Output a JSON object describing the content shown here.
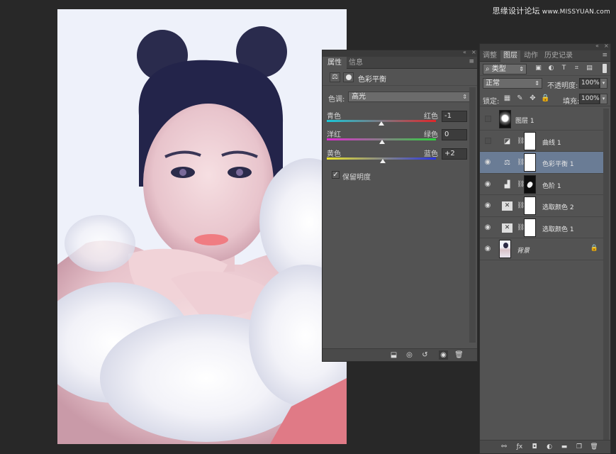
{
  "watermark": {
    "text": "思缘设计论坛",
    "url": "www.MISSYUAN.com"
  },
  "properties_panel": {
    "tabs": [
      "属性",
      "信息"
    ],
    "title": "色彩平衡",
    "tone_label": "色调:",
    "tone_value": "高光",
    "sliders": [
      {
        "left": "青色",
        "right": "红色",
        "value": "-1",
        "colors": [
          "#19c8d8",
          "#e0262a"
        ]
      },
      {
        "left": "洋红",
        "right": "绿色",
        "value": "0",
        "colors": [
          "#e02ad2",
          "#2dd23c"
        ]
      },
      {
        "left": "黄色",
        "right": "蓝色",
        "value": "+2",
        "colors": [
          "#e8e22a",
          "#2a34e0"
        ]
      }
    ],
    "preserve_luminosity": "保留明度",
    "preserve_checked": "✓"
  },
  "layers_panel": {
    "tabs": [
      "调整",
      "图层",
      "动作",
      "历史记录"
    ],
    "kind_filter": "类型",
    "blend_mode": "正常",
    "opacity_label": "不透明度:",
    "opacity_value": "100%",
    "lock_label": "锁定:",
    "fill_label": "填充:",
    "fill_value": "100%",
    "layers": [
      {
        "name": "图层 1",
        "visible": false
      },
      {
        "name": "曲线 1",
        "visible": false
      },
      {
        "name": "色彩平衡 1",
        "visible": true,
        "selected": true
      },
      {
        "name": "色阶 1",
        "visible": true
      },
      {
        "name": "选取颜色 2",
        "visible": true
      },
      {
        "name": "选取颜色 1",
        "visible": true
      },
      {
        "name": "背景",
        "visible": true
      }
    ]
  },
  "icons": {
    "eye": "eye-icon",
    "link": "chain-link-icon",
    "lock": "lock-icon"
  }
}
